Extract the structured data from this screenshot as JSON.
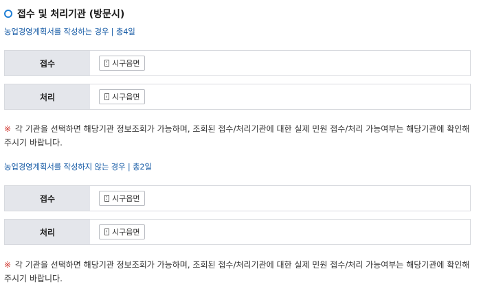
{
  "section_title": "접수 및 처리기관 (방문시)",
  "group1": {
    "heading": "농업경영계획서를 작성하는 경우 | 총4일",
    "rows": [
      {
        "label": "접수",
        "office": "시구읍면"
      },
      {
        "label": "처리",
        "office": "시구읍면"
      }
    ],
    "note_mark": "※",
    "note": "각 기관을 선택하면 해당기관 정보조회가 가능하며, 조회된 접수/처리기관에 대한 실제 민원 접수/처리 가능여부는 해당기관에 확인해 주시기 바랍니다."
  },
  "group2": {
    "heading": "농업경영계획서를 작성하지 않는 경우 | 총2일",
    "rows": [
      {
        "label": "접수",
        "office": "시구읍면"
      },
      {
        "label": "처리",
        "office": "시구읍면"
      }
    ],
    "note_mark": "※",
    "note": "각 기관을 선택하면 해당기관 정보조회가 가능하며, 조회된 접수/처리기관에 대한 실제 민원 접수/처리 가능여부는 해당기관에 확인해 주시기 바랍니다."
  },
  "colors": {
    "accent_blue": "#1f7fd6",
    "heading_blue": "#1c5fa8",
    "label_bg": "#e4e6eb",
    "note_mark_red": "#d0342c"
  }
}
